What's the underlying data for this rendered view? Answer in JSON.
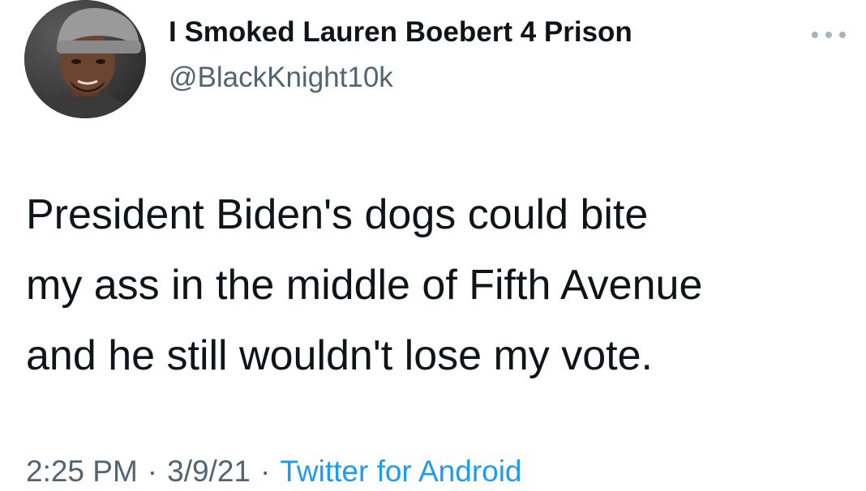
{
  "user": {
    "display_name": "I Smoked Lauren Boebert 4 Prison",
    "handle": "@BlackKnight10k",
    "avatar_icon": "user-avatar-photo"
  },
  "more_icon": "more-horizontal-icon",
  "tweet": {
    "text": "President Biden's dogs could bite\nmy ass in the middle of Fifth Avenue\nand he still wouldn't lose my vote."
  },
  "meta": {
    "time": "2:25 PM",
    "date": "3/9/21",
    "separator": "·",
    "source": "Twitter for Android"
  },
  "colors": {
    "text_primary": "#0f1419",
    "text_secondary": "#536471",
    "link": "#1d9bf0"
  }
}
